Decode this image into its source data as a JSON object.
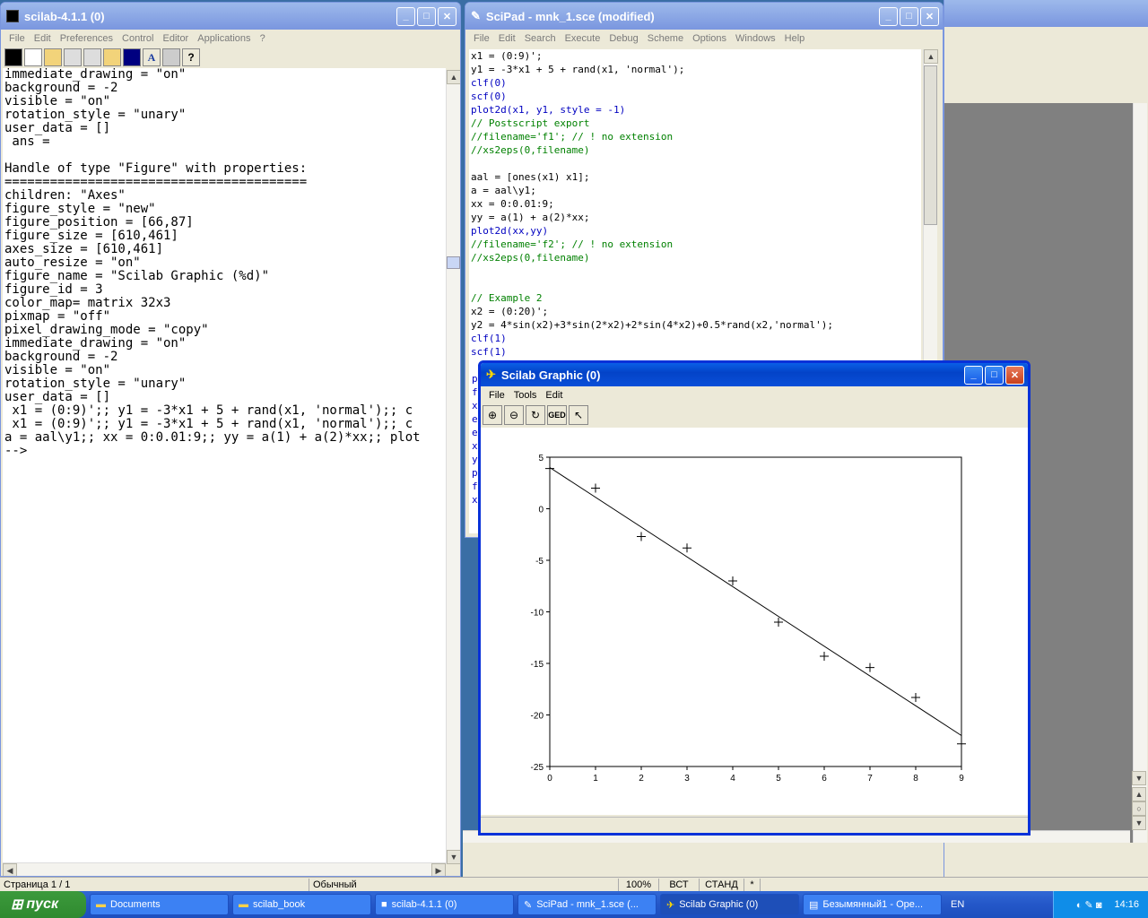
{
  "console_window": {
    "title": "scilab-4.1.1 (0)",
    "menu": [
      "File",
      "Edit",
      "Preferences",
      "Control",
      "Editor",
      "Applications",
      "?"
    ],
    "lines": [
      "immediate_drawing = \"on\"",
      "background = -2",
      "visible = \"on\"",
      "rotation_style = \"unary\"",
      "user_data = []",
      " ans =",
      "",
      "Handle of type \"Figure\" with properties:",
      "========================================",
      "children: \"Axes\"",
      "figure_style = \"new\"",
      "figure_position = [66,87]",
      "figure_size = [610,461]",
      "axes_size = [610,461]",
      "auto_resize = \"on\"",
      "figure_name = \"Scilab Graphic (%d)\"",
      "figure_id = 3",
      "color_map= matrix 32x3",
      "pixmap = \"off\"",
      "pixel_drawing_mode = \"copy\"",
      "immediate_drawing = \"on\"",
      "background = -2",
      "visible = \"on\"",
      "rotation_style = \"unary\"",
      "user_data = []",
      " x1 = (0:9)';; y1 = -3*x1 + 5 + rand(x1, 'normal');; c",
      " x1 = (0:9)';; y1 = -3*x1 + 5 + rand(x1, 'normal');; c",
      "a = aal\\y1;; xx = 0:0.01:9;; yy = a(1) + a(2)*xx;; plot",
      "-->"
    ]
  },
  "scipad": {
    "title": "SciPad - mnk_1.sce (modified)",
    "menu": [
      "File",
      "Edit",
      "Search",
      "Execute",
      "Debug",
      "Scheme",
      "Options",
      "Windows",
      "Help"
    ],
    "code": [
      "x1 = (0:9)';",
      "y1 = -3*x1 + 5 + rand(x1, 'normal');",
      "clf(0)",
      "scf(0)",
      "plot2d(x1, y1, style = -1)",
      "// Postscript export",
      "//filename='f1'; // ! no extension",
      "//xs2eps(0,filename)",
      "",
      "aal = [ones(x1) x1];",
      "a = aal\\y1;",
      "xx = 0:0.01:9;",
      "yy = a(1) + a(2)*xx;",
      "plot2d(xx,yy)",
      "//filename='f2'; // ! no extension",
      "//xs2eps(0,filename)",
      "",
      "",
      "// Example 2",
      "x2 = (0:20)';",
      "y2 = 4*sin(x2)+3*sin(2*x2)+2*sin(4*x2)+0.5*rand(x2,'normal');",
      "clf(1)",
      "scf(1)"
    ],
    "behind_lines": [
      "p",
      "f",
      "x",
      "e",
      "e",
      "x",
      "y",
      "p",
      "f",
      "x"
    ]
  },
  "graphic": {
    "title": "Scilab Graphic (0)",
    "menu": [
      "File",
      "Tools",
      "Edit"
    ],
    "ged_label": "GED"
  },
  "chart_data": {
    "type": "scatter",
    "xlim": [
      0,
      9
    ],
    "ylim": [
      -25,
      5
    ],
    "xticks": [
      "0",
      "1",
      "2",
      "3",
      "4",
      "5",
      "6",
      "7",
      "8",
      "9"
    ],
    "yticks": [
      "5",
      "0",
      "-5",
      "-10",
      "-15",
      "-20",
      "-25"
    ],
    "ytick_values": [
      5,
      0,
      -5,
      -10,
      -15,
      -20,
      -25
    ],
    "points_x": [
      0,
      1,
      2,
      3,
      4,
      5,
      6,
      7,
      8,
      9
    ],
    "points_y": [
      3.9,
      2.0,
      -2.7,
      -3.8,
      -7.0,
      -11.0,
      -14.3,
      -15.4,
      -18.3,
      -22.8
    ],
    "fit_line": {
      "x": [
        0,
        9
      ],
      "y": [
        4.0,
        -22.0
      ]
    }
  },
  "status": {
    "page": "Страница 1 / 1",
    "style": "Обычный",
    "zoom": "100%",
    "mode1": "ВСТ",
    "mode2": "СТАНД",
    "mark": "*"
  },
  "taskbar": {
    "start": "пуск",
    "tasks": [
      "Documents",
      "scilab_book",
      "scilab-4.1.1 (0)",
      "SciPad - mnk_1.sce (...",
      "Scilab Graphic (0)",
      "Безымянный1 - Ope..."
    ],
    "lang": "EN",
    "clock": "14:16"
  }
}
